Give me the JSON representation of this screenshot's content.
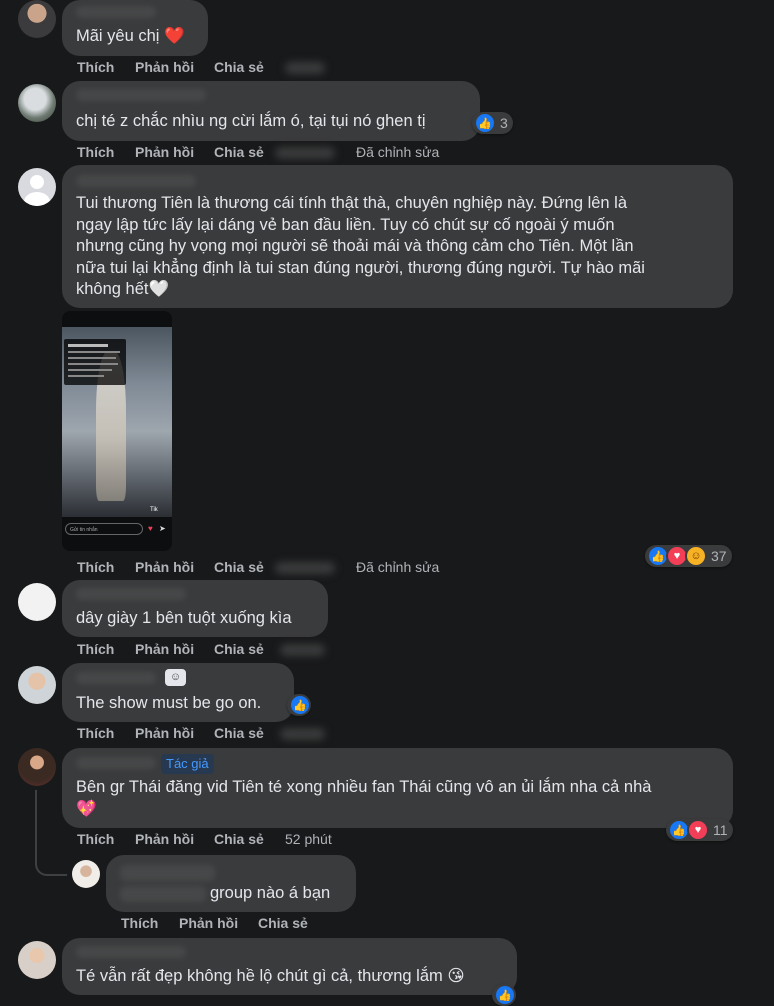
{
  "labels": {
    "like": "Thích",
    "reply": "Phản hồi",
    "share": "Chia sẻ",
    "edited": "Đã chỉnh sửa",
    "author": "Tác giả"
  },
  "comments": [
    {
      "text": "Mãi yêu chị ❤️"
    },
    {
      "text": "chị té z chắc nhìu ng cừi lắm ó, tại tụi nó ghen tị",
      "reactions": "3"
    },
    {
      "lines": [
        "Tui thương Tiên là thương cái tính thật thà, chuyên nghiệp này. Đứng lên là",
        "ngay lập tức lấy lại dáng vẻ ban đầu liền. Tuy có chút sự cố ngoài ý muốn",
        "nhưng cũng hy vọng mọi người sẽ thoải mái và thông cảm cho Tiên. Một lần",
        "nữa tui lại khẳng định là tui stan đúng người, thương đúng người. Tự hào mãi",
        "không hết🤍"
      ],
      "reactions": "37",
      "image": {
        "input_placeholder": "Gửi tin nhắn",
        "watermark": "Tik"
      }
    },
    {
      "text": "dây giày 1 bên tuột xuống kìa"
    },
    {
      "text": "The show must be go on."
    },
    {
      "text": "Bên gr Thái đăng vid Tiên té xong nhiều fan Thái cũng vô an ủi lắm nha cả nhà",
      "emoji": "💖",
      "reactions": "11",
      "time": "52 phút"
    },
    {
      "text": "group nào á bạn"
    },
    {
      "text": "Té vẫn rất đẹp không hề lộ chút gì cả, thương lắm 😘"
    }
  ],
  "colors": {
    "background": "#18191a",
    "bubble": "#3a3b3c",
    "text": "#e4e6eb",
    "secondary": "#b0b3b8",
    "like": "#1877f2",
    "love": "#f33e58"
  }
}
